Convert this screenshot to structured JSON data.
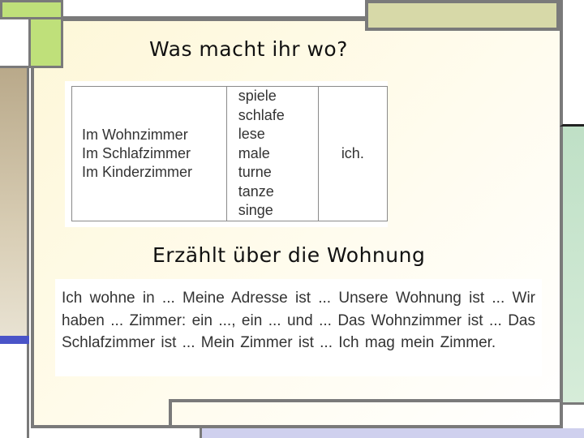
{
  "slide": {
    "heading_top": "Was macht ihr wo?",
    "heading_bottom": "Erzählt über die Wohnung"
  },
  "table": {
    "rooms": [
      "Im Wohnzimmer",
      "Im Schlafzimmer",
      "Im Kinderzimmer"
    ],
    "verbs": [
      "spiele",
      "schlafe",
      "lese",
      "male",
      "turne",
      "tanze",
      "singe"
    ],
    "pronoun": "ich."
  },
  "prompt_text": "Ich wohne in ...  Meine Adresse ist  ...  Unsere Wohnung ist ...  Wir haben ... Zimmer: ein ..., ein ...  und ...  Das Wohnzimmer ist ...  Das Schlafzimmer ist ...  Mein Zimmer ist ... Ich mag mein Zimmer."
}
